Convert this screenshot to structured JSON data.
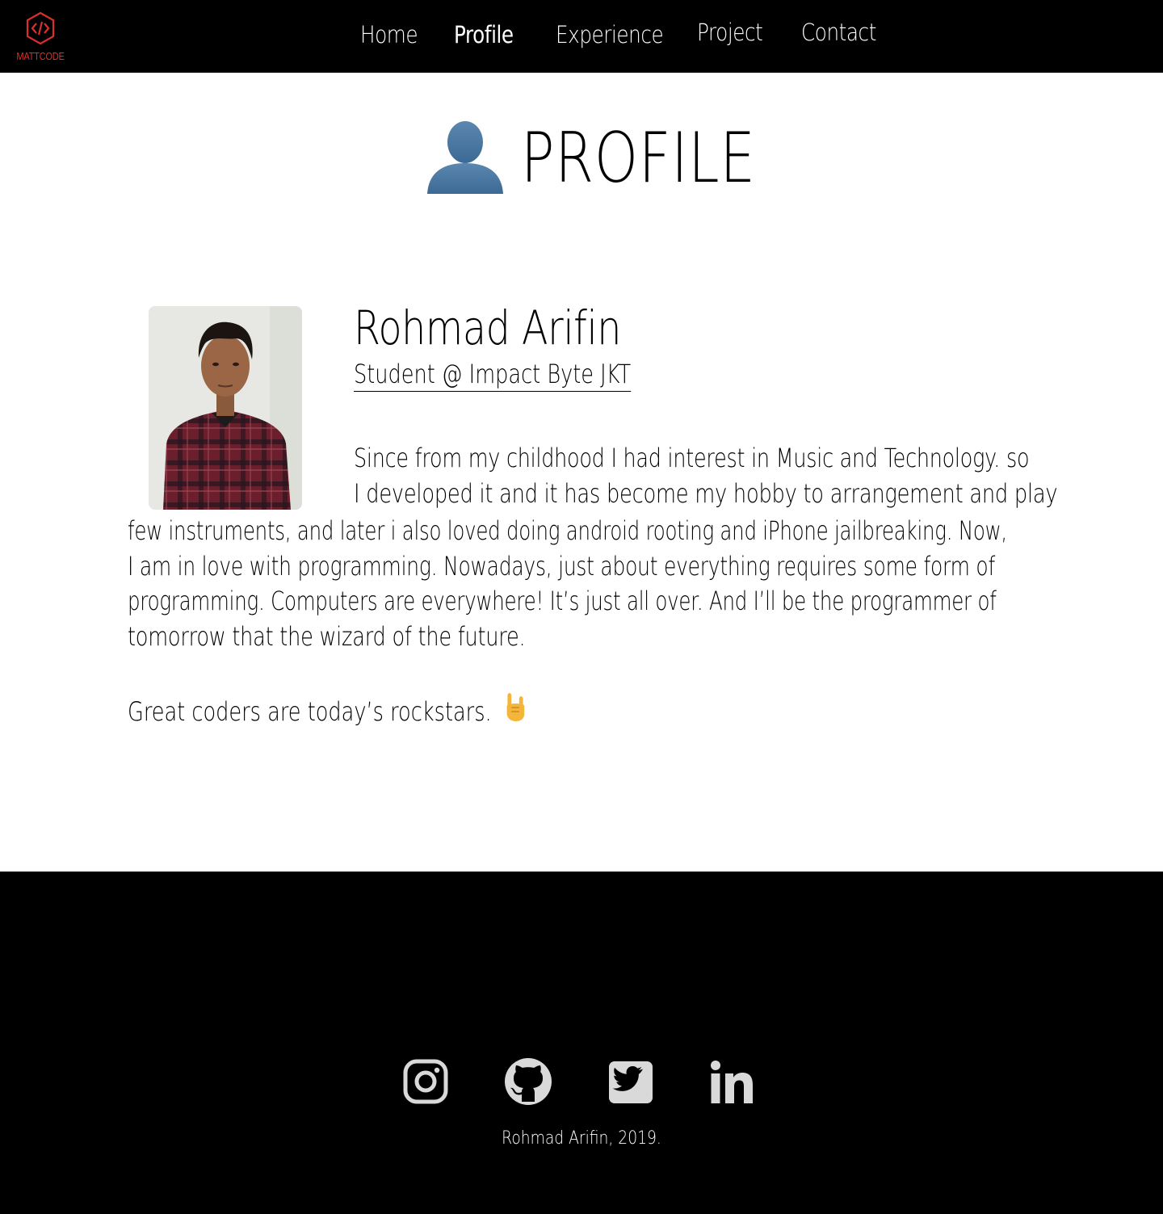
{
  "brand": {
    "logo_text": "MATTCODE",
    "accent_color": "#d9302b"
  },
  "nav": {
    "items": [
      {
        "label": "Home",
        "active": false
      },
      {
        "label": "Profile",
        "active": true
      },
      {
        "label": "Experience",
        "active": false
      },
      {
        "label": "Project",
        "active": false
      },
      {
        "label": "Contact",
        "active": false
      }
    ]
  },
  "page": {
    "title": "PROFILE",
    "title_icon": "person-silhouette-icon"
  },
  "profile": {
    "name": "Rohmad Arifin",
    "role": "Student @ Impact Byte JKT",
    "bio_lines": [
      "Since from my childhood I had interest in Music and Technology. so",
      "I developed it and it has become my hobby to arrangement and play",
      "few instruments, and later i also loved doing android rooting and iPhone jailbreaking. Now,",
      "I am in love with programming. Nowadays, just about everything requires some form of",
      "programming. Computers are everywhere! It’s just all over. And I’ll be the programmer of",
      "tomorrow that the wizard of the future."
    ],
    "quote": "Great coders are today’s rockstars.",
    "quote_icon": "sign-of-horns-icon"
  },
  "footer": {
    "social": [
      {
        "name": "instagram-icon"
      },
      {
        "name": "github-icon"
      },
      {
        "name": "twitter-icon"
      },
      {
        "name": "linkedin-icon"
      }
    ],
    "copyright": "Rohmad Arifin, 2019."
  }
}
